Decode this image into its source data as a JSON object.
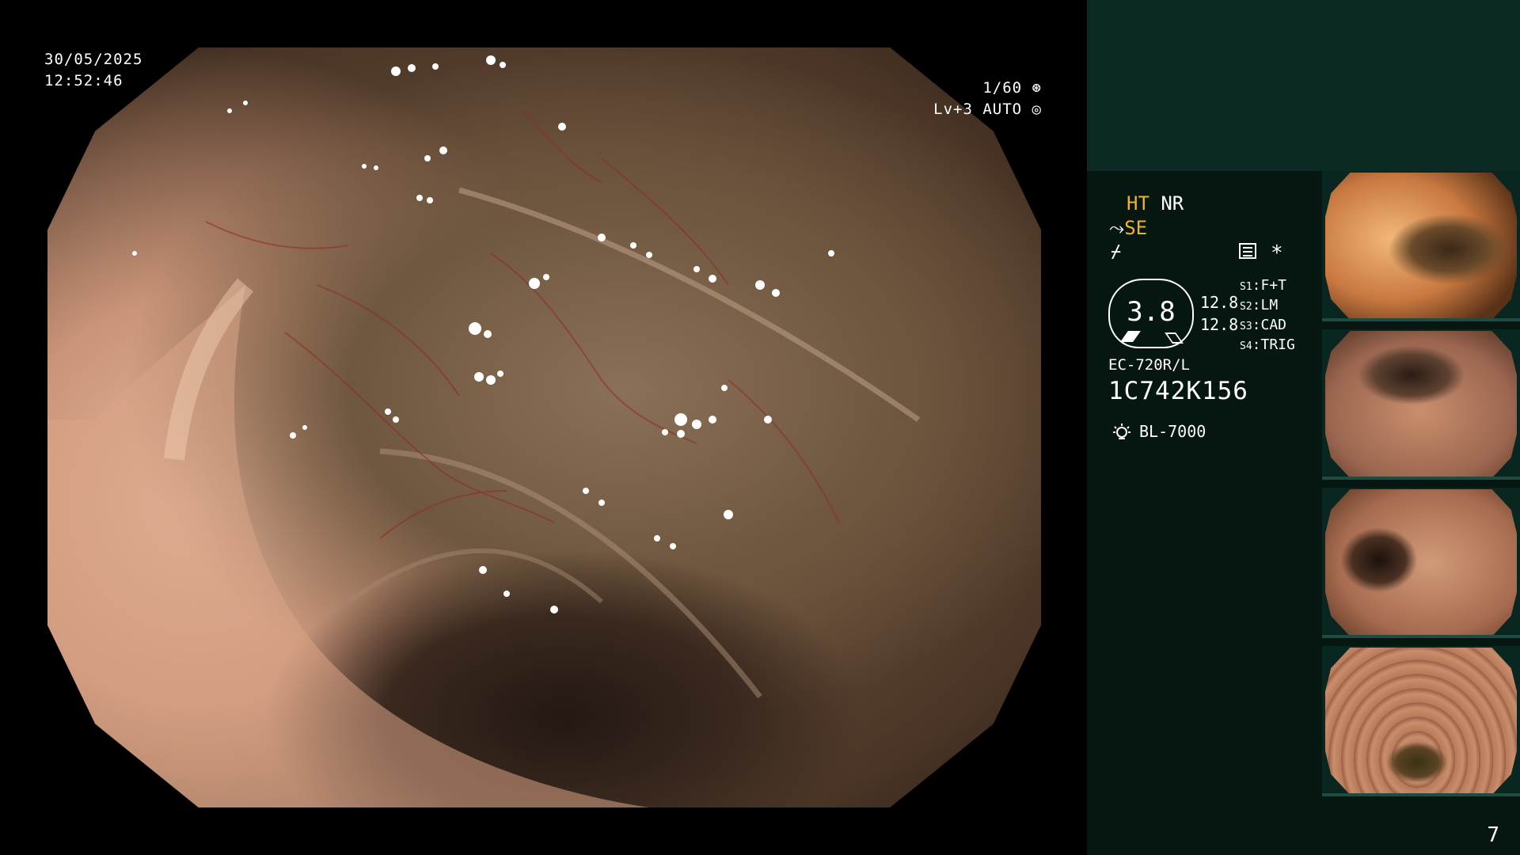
{
  "overlay": {
    "date": "30/05/2025",
    "time": "12:52:46",
    "shutter": "1/60",
    "level": "Lv+3 AUTO"
  },
  "panel": {
    "ht": "HT",
    "nr": "NR",
    "se": "SE",
    "enhance_value": "3.8",
    "side_value_1": "12.8",
    "side_value_2": "12.8",
    "scenes": [
      {
        "key": "S1",
        "value": "F+T"
      },
      {
        "key": "S2",
        "value": "LM"
      },
      {
        "key": "S3",
        "value": "CAD"
      },
      {
        "key": "S4",
        "value": "TRIG"
      }
    ],
    "scope_model": "EC-720R/L",
    "scope_serial": "1C742K156",
    "light_source": "BL-7000",
    "asterisk": "*"
  },
  "page": "7",
  "colors": {
    "panel_bg": "#061611",
    "panel_top": "#0b2a24",
    "accent_yellow": "#f0b420"
  },
  "icons": {
    "shutter": "aperture-icon",
    "level": "iris-icon",
    "se": "scope-curve-icon",
    "f": "signal-curve-icon",
    "menu": "menu-box-icon",
    "lamp": "lamp-icon"
  }
}
